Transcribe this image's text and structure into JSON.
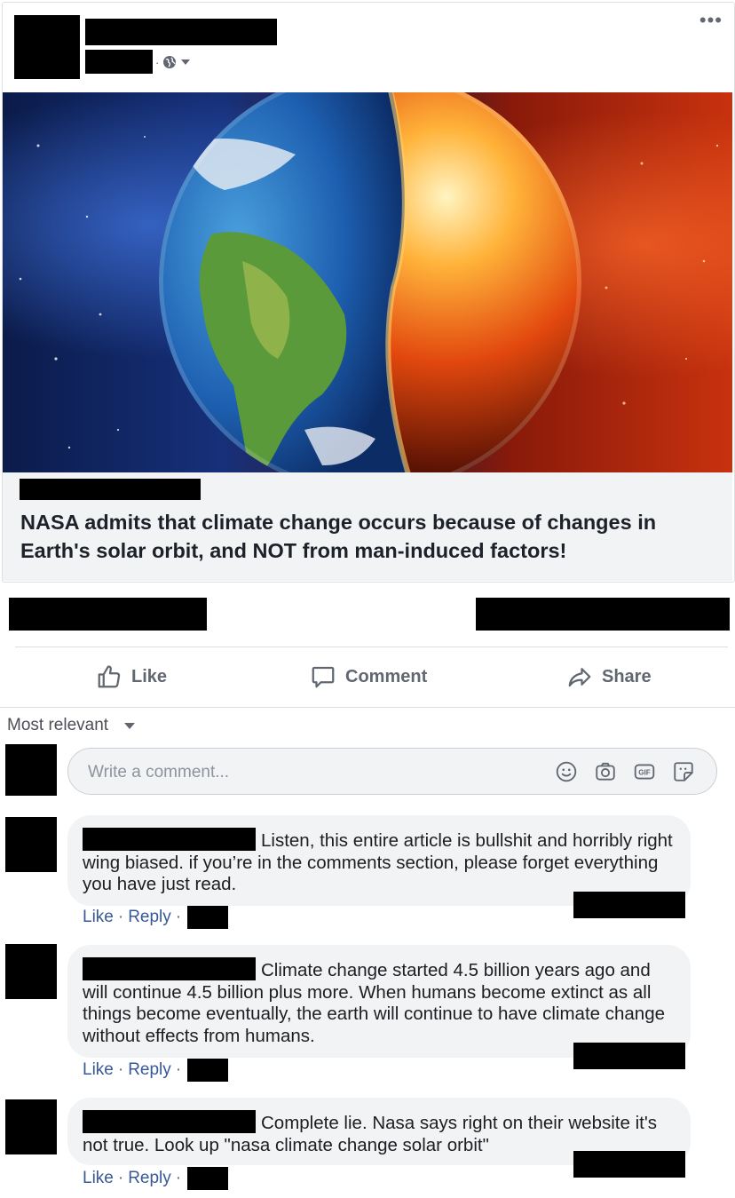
{
  "post": {
    "more_label": "•••",
    "meta_separator": "·",
    "link_title": "NASA admits that climate change occurs because of changes in Earth's solar orbit, and NOT from man-induced factors!"
  },
  "actions": {
    "like": "Like",
    "comment": "Comment",
    "share": "Share"
  },
  "comments_section": {
    "sort_label": "Most relevant",
    "input_placeholder": "Write a comment...",
    "input_icons": [
      "emoji-icon",
      "camera-icon",
      "gif-icon",
      "sticker-icon"
    ]
  },
  "comments": [
    {
      "text": "Listen, this entire article is bullshit and horribly right wing biased. if you’re in the comments section, please forget everything you have just read.",
      "like": "Like",
      "reply": "Reply",
      "sep": "·"
    },
    {
      "text": "Climate change started 4.5 billion years ago and will continue 4.5 billion plus more. When humans become extinct as all things become eventually, the earth will continue to have climate change without effects from humans.",
      "like": "Like",
      "reply": "Reply",
      "sep": "·"
    },
    {
      "text": "Complete lie. Nasa says right on their website it's not true. Look up \"nasa climate change solar orbit\"",
      "like": "Like",
      "reply": "Reply",
      "sep": "·"
    }
  ],
  "colors": {
    "link_blue": "#385898",
    "muted": "#606770",
    "bubble_bg": "#f2f3f5"
  }
}
